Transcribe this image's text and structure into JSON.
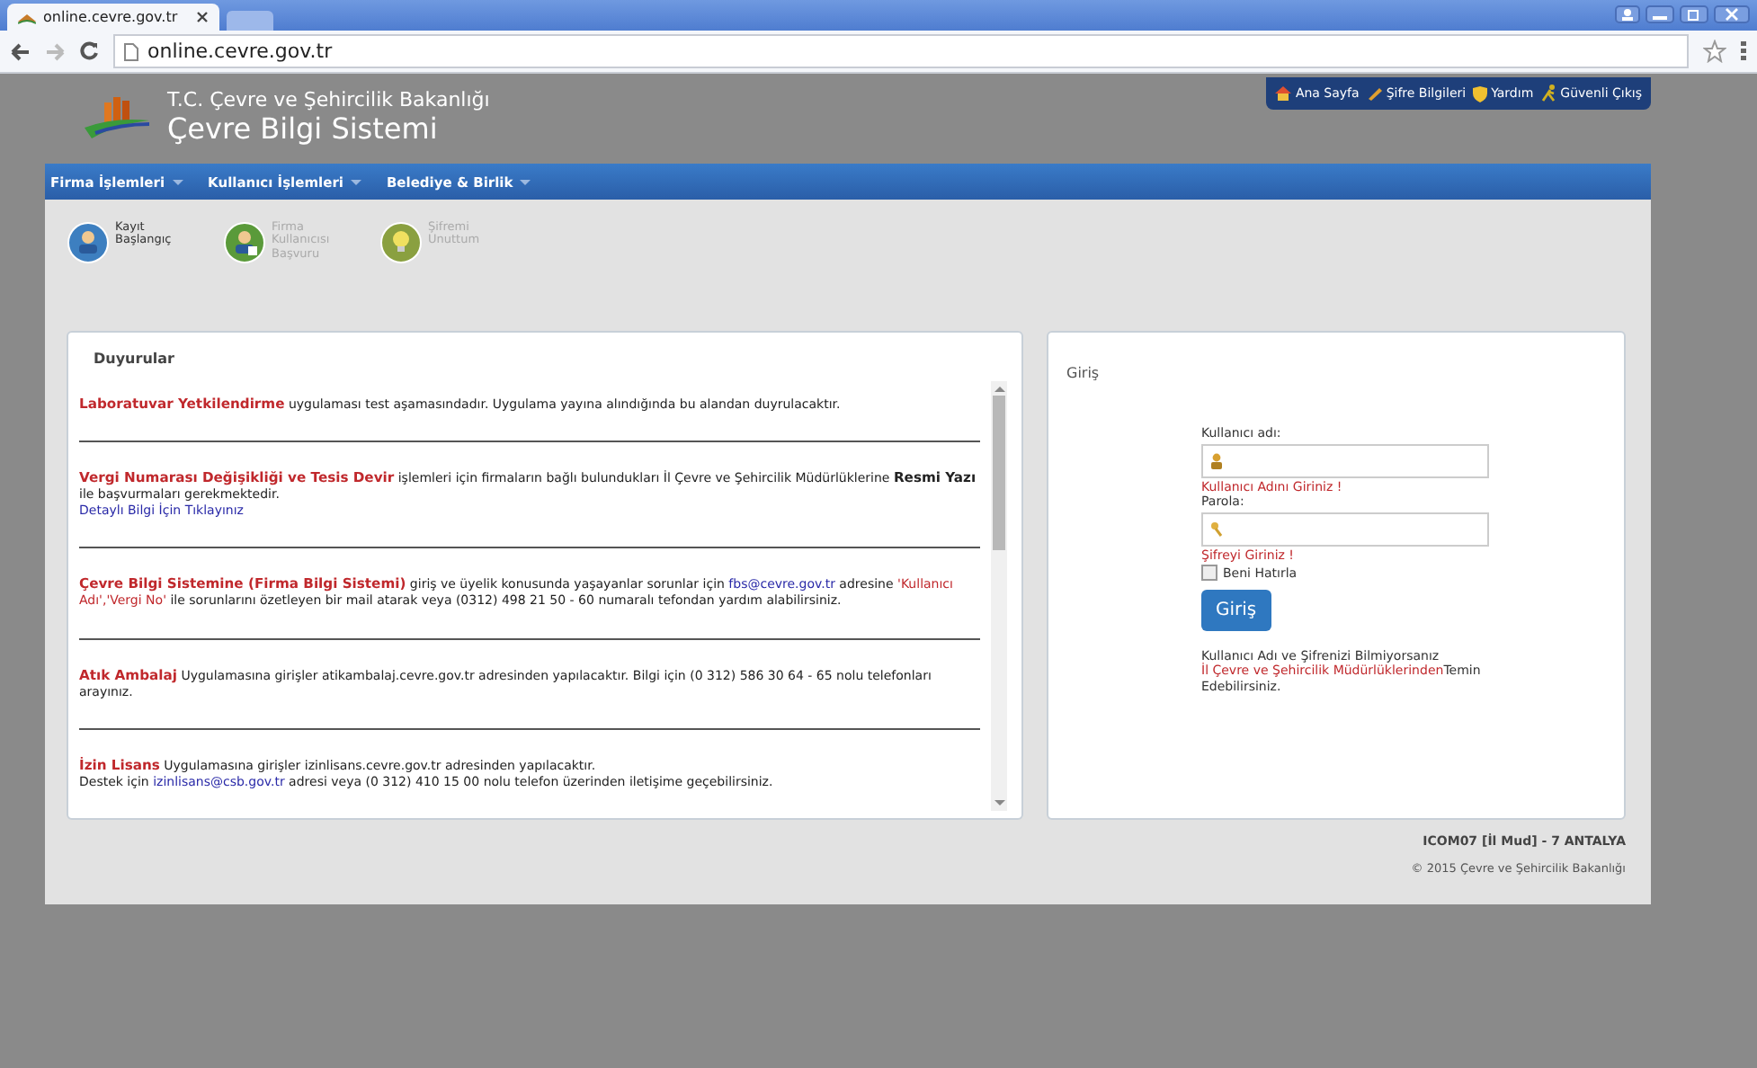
{
  "browser": {
    "tab_title": "online.cevre.gov.tr",
    "address": "online.cevre.gov.tr"
  },
  "header": {
    "ministry": "T.C. Çevre ve Şehircilik Bakanlığı",
    "system": "Çevre Bilgi Sistemi"
  },
  "top_links": [
    {
      "kind": "home",
      "label": "Ana Sayfa"
    },
    {
      "kind": "pencil",
      "label": "Şifre Bilgileri"
    },
    {
      "kind": "shield",
      "label": "Yardım"
    },
    {
      "kind": "runner",
      "label": "Güvenli Çıkış"
    }
  ],
  "menu": [
    "Firma İşlemleri",
    "Kullanıcı İşlemleri",
    "Belediye & Birlik"
  ],
  "quick_actions": [
    {
      "kind": "user",
      "label": "Kayıt Başlangıç",
      "disabled": false
    },
    {
      "kind": "add-user",
      "label": "Firma Kullanıcısı Başvuru",
      "disabled": true
    },
    {
      "kind": "bulb",
      "label": "Şifremi Unuttum",
      "disabled": true
    }
  ],
  "announcements": {
    "title": "Duyurular",
    "items": [
      {
        "lines": [
          [
            {
              "kind": "title",
              "text": "Laboratuvar Yetkilendirme"
            },
            {
              "kind": "text",
              "text": " uygulaması test aşamasındadır. Uygulama yayına alındığında bu alandan duyrulacaktır."
            }
          ]
        ]
      },
      {
        "lines": [
          [
            {
              "kind": "title",
              "text": "Vergi Numarası Değişikliği ve Tesis Devir"
            },
            {
              "kind": "text",
              "text": " işlemleri için firmaların bağlı bulundukları İl Çevre ve Şehircilik Müdürlüklerine "
            },
            {
              "kind": "strong",
              "text": "Resmi Yazı"
            },
            {
              "kind": "text",
              "text": " ile başvurmaları gerekmektedir."
            }
          ],
          [
            {
              "kind": "link",
              "text": "Detaylı Bilgi İçin Tıklayınız"
            }
          ]
        ]
      },
      {
        "lines": [
          [
            {
              "kind": "title",
              "text": "Çevre Bilgi Sistemine (Firma Bilgi Sistemi)"
            },
            {
              "kind": "text",
              "text": " giriş ve üyelik konusunda yaşayanlar sorunlar için "
            },
            {
              "kind": "link",
              "text": "fbs@cevre.gov.tr"
            },
            {
              "kind": "text",
              "text": " adresine "
            },
            {
              "kind": "quote",
              "text": "'Kullanıcı Adı','Vergi No'"
            },
            {
              "kind": "text",
              "text": " ile sorunlarını özetleyen bir mail atarak veya (0312) 498 21 50 - 60 numaralı tefondan yardım alabilirsiniz."
            }
          ]
        ]
      },
      {
        "lines": [
          [
            {
              "kind": "title",
              "text": "Atık Ambalaj"
            },
            {
              "kind": "text",
              "text": " Uygulamasına girişler atikambalaj.cevre.gov.tr adresinden yapılacaktır. Bilgi için (0 312) 586 30 64 - 65 nolu telefonları arayınız."
            }
          ]
        ]
      },
      {
        "lines": [
          [
            {
              "kind": "title",
              "text": "İzin Lisans"
            },
            {
              "kind": "text",
              "text": " Uygulamasına girişler izinlisans.cevre.gov.tr adresinden yapılacaktır."
            }
          ],
          [
            {
              "kind": "text",
              "text": "Destek için "
            },
            {
              "kind": "link",
              "text": "izinlisans@csb.gov.tr"
            },
            {
              "kind": "text",
              "text": " adresi veya (0 312) 410 15 00 nolu telefon üzerinden iletişime geçebilirsiniz."
            }
          ]
        ]
      }
    ]
  },
  "login": {
    "title": "Giriş",
    "username_label": "Kullanıcı adı:",
    "username_error": "Kullanıcı Adını Giriniz !",
    "password_label": "Parola:",
    "password_error": "Şifreyi Giriniz !",
    "remember": {
      "label": "Beni Hatırla",
      "checked": false
    },
    "button": "Giriş",
    "note": "Kullanıcı Adı ve Şifrenizi Bilmiyorsanız ",
    "note_link": "İl Çevre ve Şehircilik Müdürlüklerinden",
    "note_end": "Temin Edebilirsiniz."
  },
  "footer": {
    "unit": "ICOM07 [İl Mud] - 7 ANTALYA",
    "copyright": "© 2015 Çevre ve Şehircilik Bakanlığı"
  }
}
